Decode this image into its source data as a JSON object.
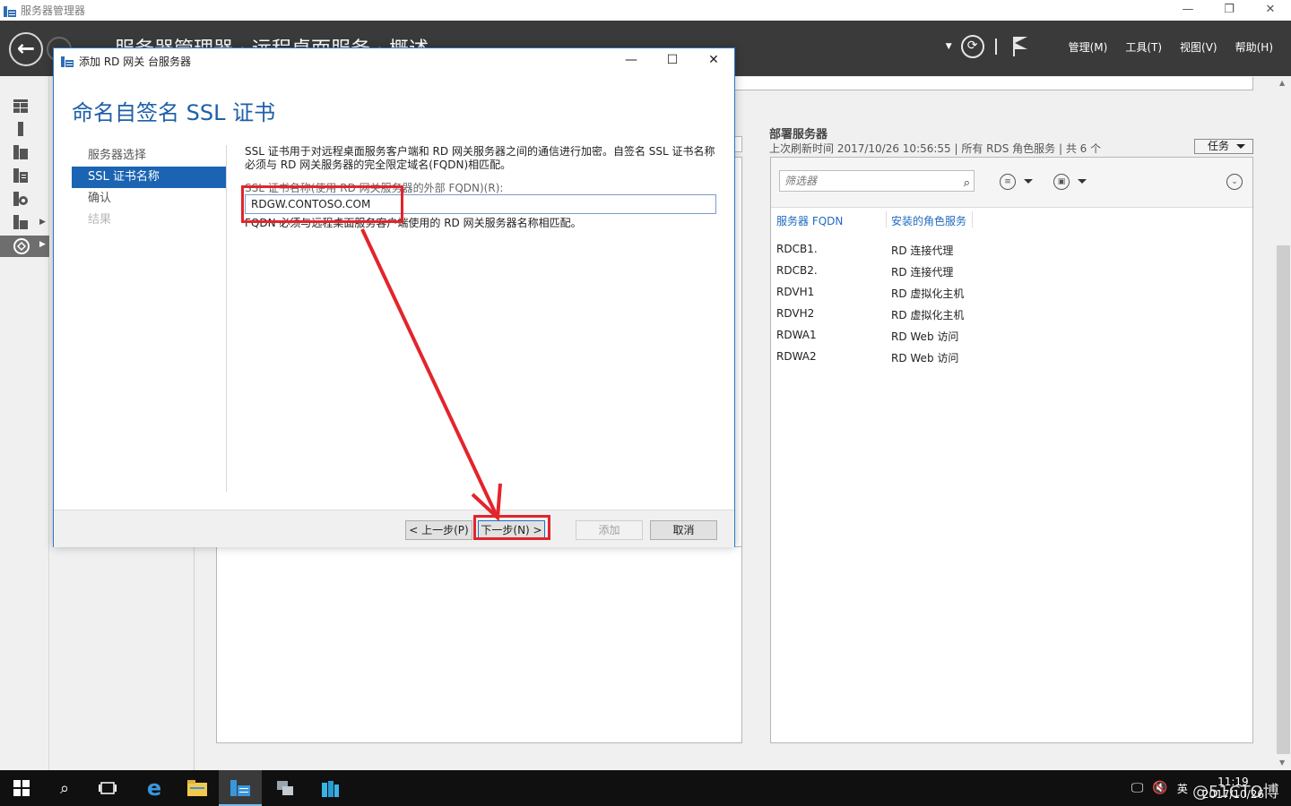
{
  "app": {
    "title": "服务器管理器",
    "window_controls": [
      "—",
      "❐",
      "✕"
    ]
  },
  "header": {
    "breadcrumb": "服务器管理器 · 远程桌面服务 · 概述",
    "menus": [
      "管理(M)",
      "工具(T)",
      "视图(V)",
      "帮助(H)"
    ]
  },
  "dialog": {
    "title": "添加 RD 网关 台服务器",
    "heading": "命名自签名 SSL 证书",
    "nav": [
      {
        "label": "服务器选择",
        "state": "normal"
      },
      {
        "label": "SSL 证书名称",
        "state": "active"
      },
      {
        "label": "确认",
        "state": "normal"
      },
      {
        "label": "结果",
        "state": "disabled"
      }
    ],
    "description": "SSL 证书用于对远程桌面服务客户端和 RD 网关服务器之间的通信进行加密。自签名 SSL 证书名称必须与 RD 网关服务器的完全限定域名(FQDN)相匹配。",
    "field_label": "SSL 证书名称(使用 RD 网关服务器的外部 FQDN)(R):",
    "field_value": "RDGW.CONTOSO.COM",
    "field_note": "FQDN 必须与远程桌面服务客户端使用的 RD 网关服务器名称相匹配。",
    "buttons": {
      "prev": "< 上一步(P)",
      "next": "下一步(N) >",
      "add": "添加",
      "cancel": "取消"
    }
  },
  "deploy": {
    "title": "部署服务器",
    "subtitle": "上次刷新时间 2017/10/26 10:56:55 | 所有 RDS 角色服务 | 共 6 个",
    "tasks_label": "任务",
    "filter_placeholder": "筛选器",
    "columns": [
      "服务器 FQDN",
      "安装的角色服务"
    ],
    "rows": [
      {
        "fqdn": "RDCB1.",
        "role": "RD 连接代理"
      },
      {
        "fqdn": "RDCB2.",
        "role": "RD 连接代理"
      },
      {
        "fqdn": "RDVH1",
        "role": "RD 虚拟化主机"
      },
      {
        "fqdn": "RDVH2",
        "role": "RD 虚拟化主机"
      },
      {
        "fqdn": "RDWA1",
        "role": "RD Web 访问"
      },
      {
        "fqdn": "RDWA2",
        "role": "RD Web 访问"
      }
    ]
  },
  "taskbar": {
    "ime": "英",
    "time": "11:19",
    "date": "2017/10/26",
    "watermark": "@51CTO博客"
  }
}
